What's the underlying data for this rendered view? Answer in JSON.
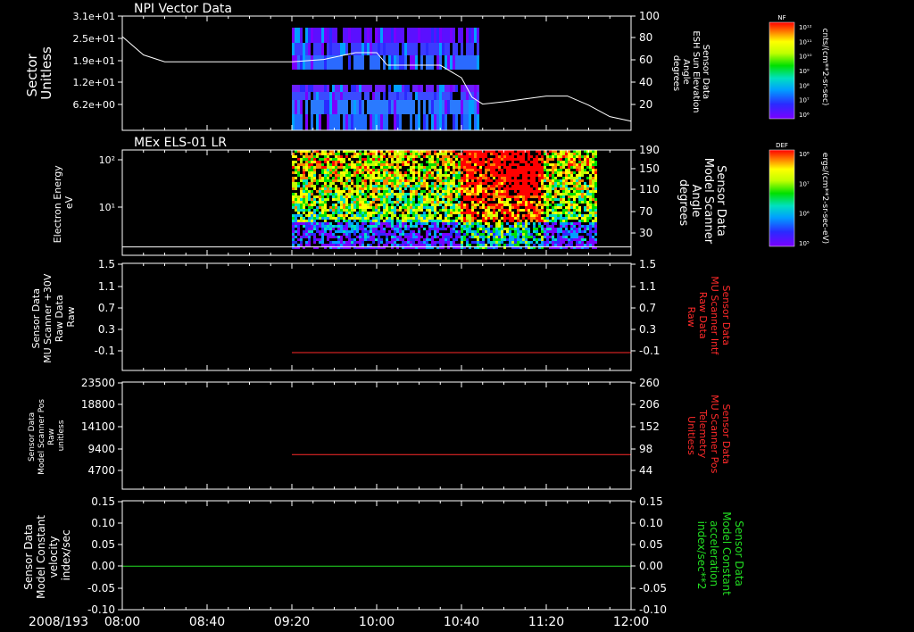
{
  "colors": {
    "background": "#000000",
    "axes": "#ffffff",
    "red_trace": "#ff2a2a",
    "green_trace": "#22dd22",
    "colorbar_scale": [
      "#7a00ff",
      "#2a2aff",
      "#00a0ff",
      "#00e0c0",
      "#00e000",
      "#c0ff00",
      "#ffff00",
      "#ff8000",
      "#ff0000"
    ]
  },
  "footer": {
    "date_label": "2008/193"
  },
  "time_axis": {
    "tick_labels": [
      "08:00",
      "08:40",
      "09:20",
      "10:00",
      "10:40",
      "11:20",
      "12:00"
    ],
    "range": [
      "08:00",
      "12:00"
    ]
  },
  "panels": [
    {
      "title": "NPI Vector Data",
      "left_label": [
        "Sector",
        "Unitless"
      ],
      "left_ticks": [
        "3.1e+01",
        "2.5e+01",
        "1.9e+01",
        "1.2e+01",
        "6.2e+00"
      ],
      "right_label": [
        "Sensor Data",
        "ESH Sun Elevation",
        "Angle",
        "degrees"
      ],
      "right_ticks": [
        "100",
        "80",
        "60",
        "40",
        "20"
      ],
      "colorbar": {
        "title": "NF",
        "ticks": [
          "10¹²",
          "10¹¹",
          "10¹⁰",
          "10⁹",
          "10⁸",
          "10⁷",
          "10⁶"
        ],
        "unit": "cnts/(cm**2-sr-sec)"
      }
    },
    {
      "title": "MEx ELS-01 LR",
      "left_label": [
        "Electron Energy",
        "eV"
      ],
      "left_ticks": [
        "10²",
        "10¹"
      ],
      "right_label": [
        "Sensor Data",
        "Model Scanner",
        "Angle",
        "degrees"
      ],
      "right_ticks": [
        "190",
        "150",
        "110",
        "70",
        "30"
      ],
      "colorbar": {
        "title": "DEF",
        "ticks": [
          "10⁸",
          "10⁷",
          "10⁶",
          "10⁵"
        ],
        "unit": "ergs/(cm**2-sr-sec-eV)"
      }
    },
    {
      "left_label": [
        "Sensor Data",
        "MU Scanner +30V",
        "Raw Data",
        "Raw"
      ],
      "left_ticks": [
        "1.5",
        "1.1",
        "0.7",
        "0.3",
        "-0.1"
      ],
      "right_label": [
        "Sensor Data",
        "MU Scanner Intf",
        "Raw Data",
        "Raw"
      ],
      "right_ticks": [
        "1.5",
        "1.1",
        "0.7",
        "0.3",
        "-0.1"
      ]
    },
    {
      "left_label": [
        "Sensor Data",
        "Model Scanner Pos",
        "Raw",
        "unitless"
      ],
      "left_ticks": [
        "23500",
        "18800",
        "14100",
        "9400",
        "4700"
      ],
      "right_label": [
        "Sensor Data",
        "MU Scanner Pos",
        "Telemetry",
        "Unitless"
      ],
      "right_ticks": [
        "260",
        "206",
        "152",
        "98",
        "44"
      ]
    },
    {
      "left_label": [
        "Sensor Data",
        "Model Constant",
        "velocity",
        "index/sec"
      ],
      "left_ticks": [
        "0.15",
        "0.10",
        "0.05",
        "0.00",
        "-0.05",
        "-0.10"
      ],
      "right_label": [
        "Sensor Data",
        "Model Constant",
        "acceleration",
        "index/sec**2"
      ],
      "right_ticks": [
        "0.15",
        "0.10",
        "0.05",
        "0.00",
        "-0.05",
        "-0.10"
      ]
    }
  ],
  "chart_data": [
    {
      "type": "heatmap",
      "title": "NPI Vector Data",
      "x_range": [
        "08:00",
        "12:00"
      ],
      "y_ticks": [
        31,
        25,
        19,
        12,
        6.2
      ],
      "data_span": [
        "09:20",
        "10:48"
      ],
      "line_series": {
        "name": "Sensor Data ESH Sun Elevation Angle",
        "x": [
          "08:00",
          "08:10",
          "08:20",
          "09:00",
          "09:20",
          "09:35",
          "09:50",
          "10:00",
          "10:05",
          "10:30",
          "10:40",
          "10:45",
          "10:50",
          "11:00",
          "11:20",
          "11:30",
          "11:40",
          "11:50",
          "12:00"
        ],
        "y": [
          82,
          66,
          60,
          60,
          60,
          62,
          68,
          68,
          57,
          57,
          46,
          29,
          23,
          25,
          30,
          30,
          22,
          12,
          8
        ]
      }
    },
    {
      "type": "heatmap",
      "title": "MEx ELS-01 LR",
      "x_range": [
        "08:00",
        "12:00"
      ],
      "y_log": true,
      "y_ticks": [
        100,
        10
      ],
      "data_span": [
        "09:20",
        "11:44"
      ],
      "line_series": {
        "name": "Sensor Data Model Scanner Angle",
        "x": [
          "08:00",
          "12:00"
        ],
        "y": [
          15,
          15
        ]
      }
    },
    {
      "type": "line",
      "x_range": [
        "08:00",
        "12:00"
      ],
      "ylim": [
        -0.3,
        1.5
      ],
      "series": [
        {
          "x": [
            "09:20",
            "12:00"
          ],
          "y": [
            0,
            0
          ]
        }
      ]
    },
    {
      "type": "line",
      "x_range": [
        "08:00",
        "12:00"
      ],
      "ylim": [
        0,
        23500
      ],
      "series": [
        {
          "x": [
            "09:20",
            "12:00"
          ],
          "y": [
            7600,
            7600
          ]
        }
      ]
    },
    {
      "type": "line",
      "x_range": [
        "08:00",
        "12:00"
      ],
      "ylim": [
        -0.1,
        0.15
      ],
      "series": [
        {
          "x": [
            "08:00",
            "12:00"
          ],
          "y": [
            0.0,
            0.0
          ]
        }
      ]
    }
  ]
}
